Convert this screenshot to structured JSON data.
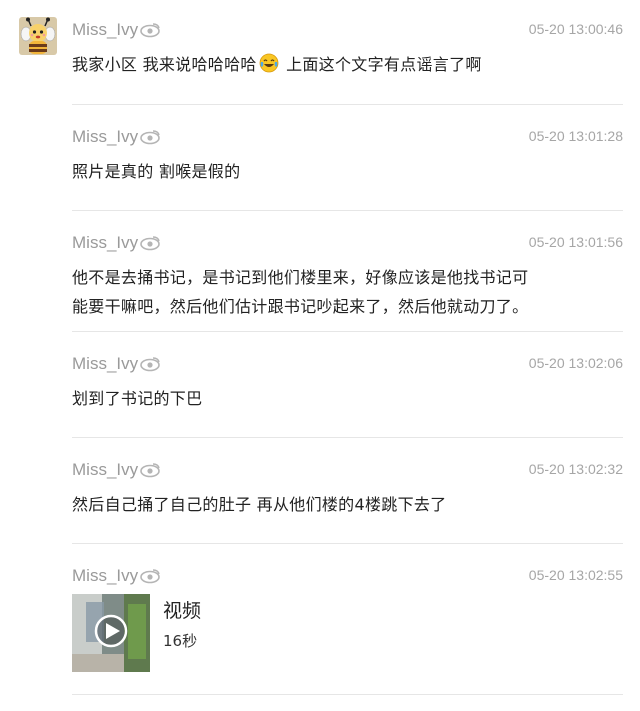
{
  "comments": [
    {
      "username": "Miss_Ivy",
      "time": "05-20 13:00:46",
      "text_before": "我家小区 我来说哈哈哈哈",
      "emoji": "laughing-tears-emoji",
      "text_after": " 上面这个文字有点谣言了啊"
    },
    {
      "username": "Miss_Ivy",
      "time": "05-20 13:01:28",
      "text": "照片是真的 割喉是假的"
    },
    {
      "username": "Miss_Ivy",
      "time": "05-20 13:01:56",
      "line1": "他不是去捅书记，是书记到他们楼里来，好像应该是他找书记可",
      "line2": "能要干嘛吧，然后他们估计跟书记吵起来了，然后他就动刀了。"
    },
    {
      "username": "Miss_Ivy",
      "time": "05-20 13:02:06",
      "text": "划到了书记的下巴"
    },
    {
      "username": "Miss_Ivy",
      "time": "05-20 13:02:32",
      "text": "然后自己捅了自己的肚子 再从他们楼的4楼跳下去了"
    },
    {
      "username": "Miss_Ivy",
      "time": "05-20 13:02:55",
      "video": {
        "title": "视频",
        "duration": "16秒"
      }
    }
  ],
  "colors": {
    "name": "#9a9a9a",
    "time": "#a6a6a6",
    "text": "#222222",
    "divider": "#e6e6e6"
  },
  "icons": {
    "verified_badge": "weibo-eye-icon",
    "avatar": "cartoon-bee-avatar",
    "play": "play-icon"
  }
}
